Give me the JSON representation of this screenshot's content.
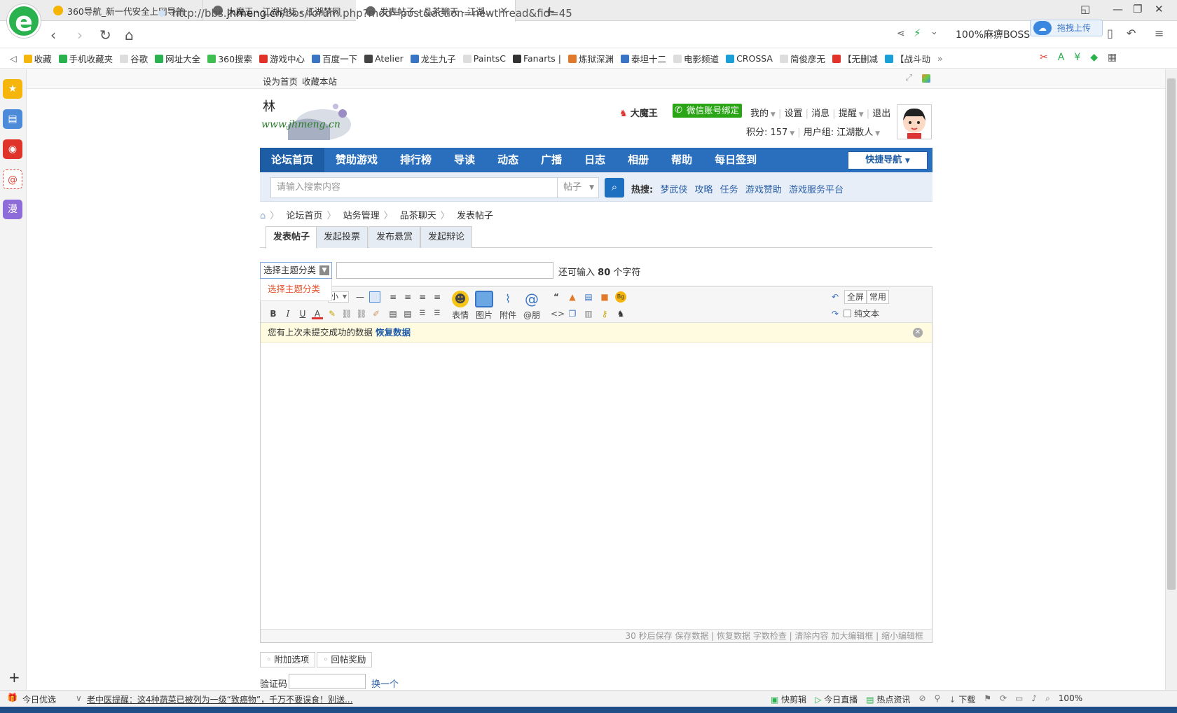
{
  "browser": {
    "tabs": [
      {
        "title": "360导航_新一代安全上网导航",
        "icon_color": "#f4b400"
      },
      {
        "title": "大魔王 - 江湖论坛 - 江湖梦网",
        "icon_color": "#666666"
      },
      {
        "title": "发表帖子 - 品茶聊天 - 江湖论坛",
        "icon_color": "#666666"
      }
    ],
    "new_tab": "+",
    "url_prefix": "http://bbs.",
    "url_domain": "jhmeng.cn",
    "url_path": "/bbs/forum.php?mod=post&action=newthread&fid=45",
    "ad_text": "100%麻痹BOSS",
    "upload_label": "拖拽上传",
    "bookmarks": [
      "收藏",
      "手机收藏夹",
      "谷歌",
      "网址大全",
      "360搜索",
      "游戏中心",
      "百度一下",
      "Atelier",
      "龙生九子",
      "PaintsC",
      "Fanarts |",
      "炼狱深渊",
      "泰坦十二",
      "电影频道",
      "CROSSA",
      "简俊彦无",
      "【无删减",
      "【战斗动"
    ],
    "bookmark_more": "»",
    "sidebar_plus": "+",
    "sidebar_items": [
      {
        "name": "favorites",
        "glyph": "★",
        "color": "#f5b50a"
      },
      {
        "name": "news",
        "glyph": "▤",
        "color": "#4c8bd9"
      },
      {
        "name": "weibo",
        "glyph": "◉",
        "color": "#e0342a"
      },
      {
        "name": "mail",
        "glyph": "@",
        "color": "#e04a3a"
      },
      {
        "name": "comic",
        "glyph": "漫",
        "color": "#8d6bd8"
      }
    ]
  },
  "forum": {
    "topbar": {
      "set_home": "设为首页",
      "bookmark_site": "收藏本站"
    },
    "logo_text": "www.jhmeng.cn",
    "logo_char": "林",
    "user": {
      "name": "大魔王",
      "wechat": "微信账号绑定",
      "menu": [
        "我的",
        "设置",
        "消息",
        "提醒",
        "退出"
      ],
      "points": "积分: 157",
      "group": "用户组: 江湖散人"
    },
    "nav": [
      "论坛首页",
      "赞助游戏",
      "排行榜",
      "导读",
      "动态",
      "广播",
      "日志",
      "相册",
      "帮助",
      "每日签到"
    ],
    "quick_nav": "快捷导航",
    "search": {
      "placeholder": "请输入搜索内容",
      "type": "帖子",
      "hot_label": "热搜:",
      "hot": [
        "梦武侠",
        "攻略",
        "任务",
        "游戏赞助",
        "游戏服务平台"
      ]
    },
    "breadcrumb": [
      "论坛首页",
      "站务管理",
      "品茶聊天",
      "发表帖子"
    ],
    "post_tabs": [
      "发表帖子",
      "发起投票",
      "发布悬赏",
      "发起辩论"
    ],
    "type_select": "选择主题分类",
    "type_option": "选择主题分类",
    "remain_prefix": "还可输入",
    "remain_count": "80",
    "remain_suffix": "个字符",
    "toolbar": {
      "size_label": "小",
      "emoji": "表情",
      "image": "图片",
      "attach": "附件",
      "at": "@朋",
      "fullscreen": "全屏",
      "common": "常用",
      "plain": "纯文本"
    },
    "restore_msg": "您有上次未提交成功的数据",
    "restore_link": "恢复数据",
    "editor_footer": "30 秒后保存 保存数据 | 恢复数据    字数检查 | 清除内容    加大编辑框 | 缩小编辑框",
    "options": [
      "附加选项",
      "回帖奖励"
    ],
    "captcha_label": "验证码",
    "captcha_change": "换一个"
  },
  "statusbar": {
    "left": "今日优选",
    "news": "老中医提醒：这4种蔬菜已被列为一级“致癌物”，千万不要误食！别送...",
    "right": [
      "快剪辑",
      "今日直播",
      "热点资讯",
      "下载"
    ],
    "zoom": "100%"
  },
  "colors": {
    "nav_bg": "#2a6fbd",
    "accent": "#1d6fc0",
    "wechat": "#2aa515"
  }
}
